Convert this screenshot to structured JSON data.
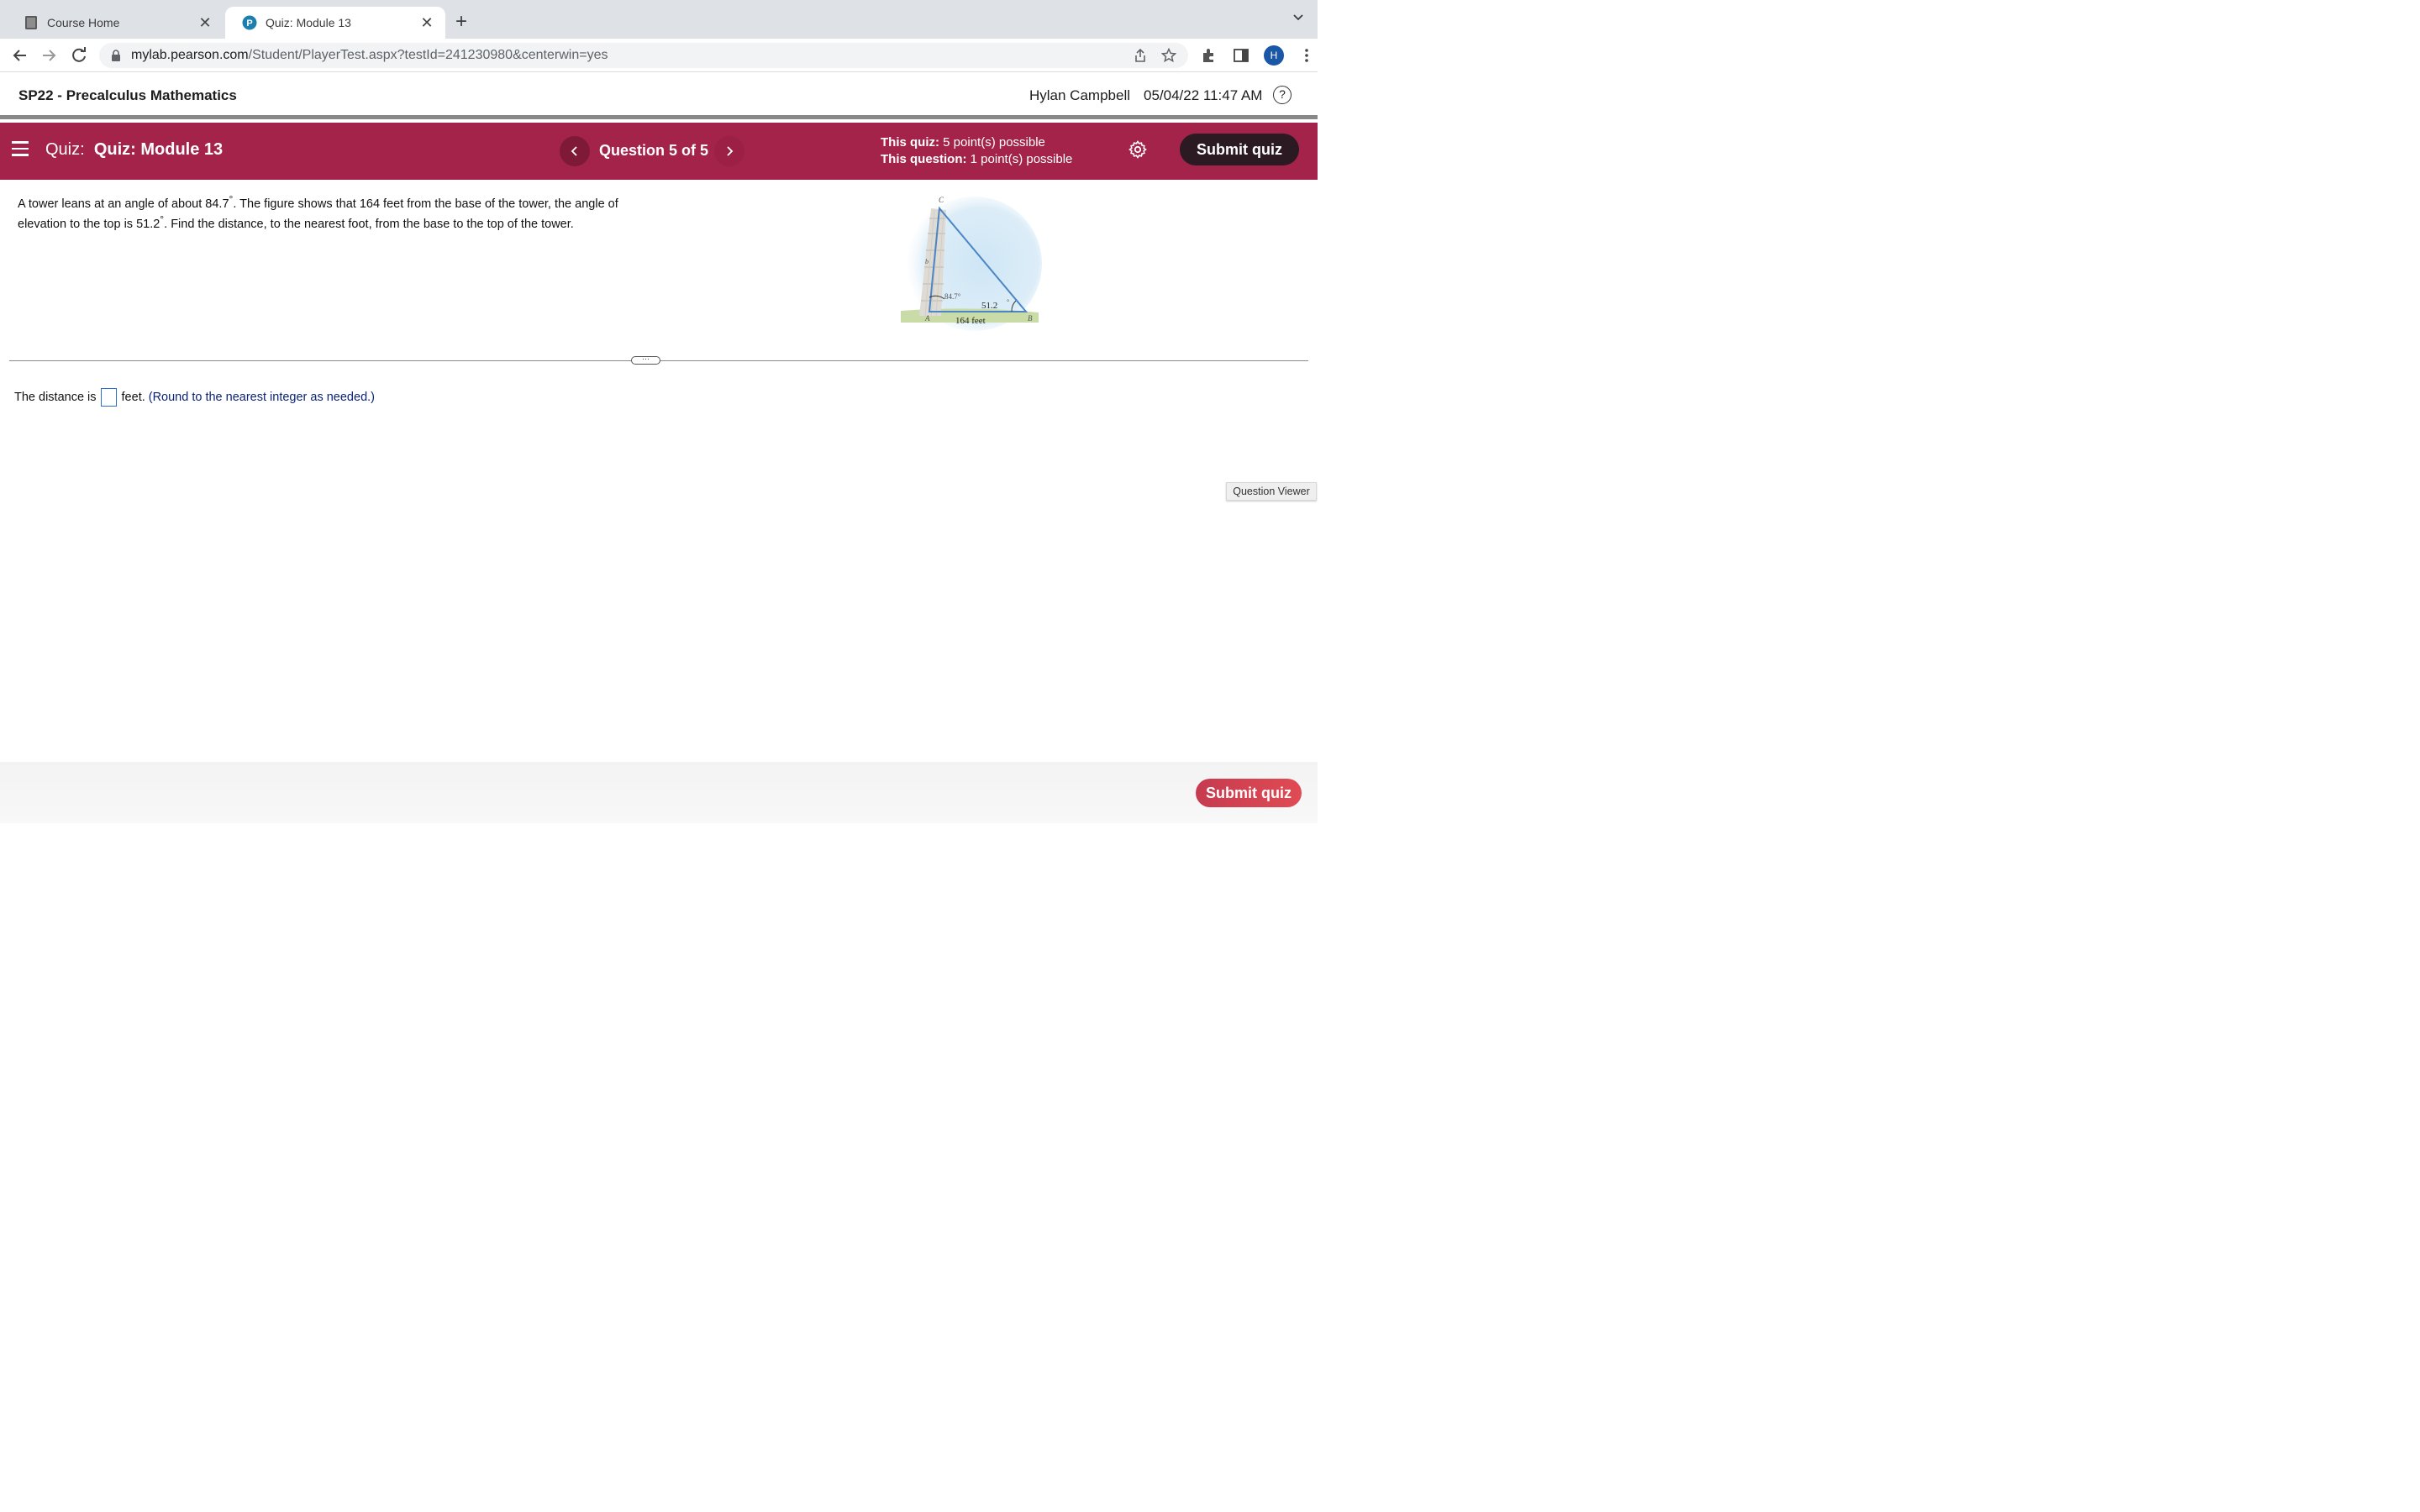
{
  "browser": {
    "tabs": [
      {
        "title": "Course Home",
        "icon": "book-icon"
      },
      {
        "title": "Quiz: Module 13",
        "icon": "pearson-icon"
      }
    ],
    "close_glyph": "✕",
    "new_tab_glyph": "+",
    "url_host": "mylab.pearson.com",
    "url_path": "/Student/PlayerTest.aspx?testId=241230980&centerwin=yes",
    "avatar_letter": "H"
  },
  "course": {
    "title": "SP22 - Precalculus Mathematics",
    "user": "Hylan Campbell",
    "datetime": "05/04/22 11:47 AM"
  },
  "quizbar": {
    "prefix": "Quiz:",
    "name": "Quiz: Module 13",
    "question_label": "Question 5 of 5",
    "quiz_points_label": "This quiz:",
    "quiz_points_value": "5 point(s) possible",
    "question_points_label": "This question:",
    "question_points_value": "1 point(s) possible",
    "submit_label": "Submit quiz"
  },
  "question": {
    "text_part1": "A tower leans at an angle of about 84.7",
    "text_part2": ". The figure shows that 164 feet from the base of the tower, the angle of elevation to the top is 51.2",
    "text_part3": ". Find the distance, to the nearest foot, from the base to the top of the tower.",
    "degree": "°",
    "figure": {
      "vertex_c": "C",
      "vertex_a": "A",
      "vertex_b": "B",
      "side_b": "b",
      "angle_a": "84.7°",
      "angle_b": "51.2",
      "angle_b_deg": "°",
      "base": "164  feet"
    }
  },
  "answer": {
    "prefix": "The distance is",
    "suffix": "feet.",
    "hint": "(Round to the nearest integer as needed.)"
  },
  "question_viewer_label": "Question Viewer",
  "divider_handle": "···",
  "footer": {
    "submit_label": "Submit quiz"
  },
  "colors": {
    "quizbar": "#a3234a",
    "submit_dark": "#2b1a22",
    "submit_bottom": "#d9434f",
    "answer_box": "#2a6ed1"
  }
}
